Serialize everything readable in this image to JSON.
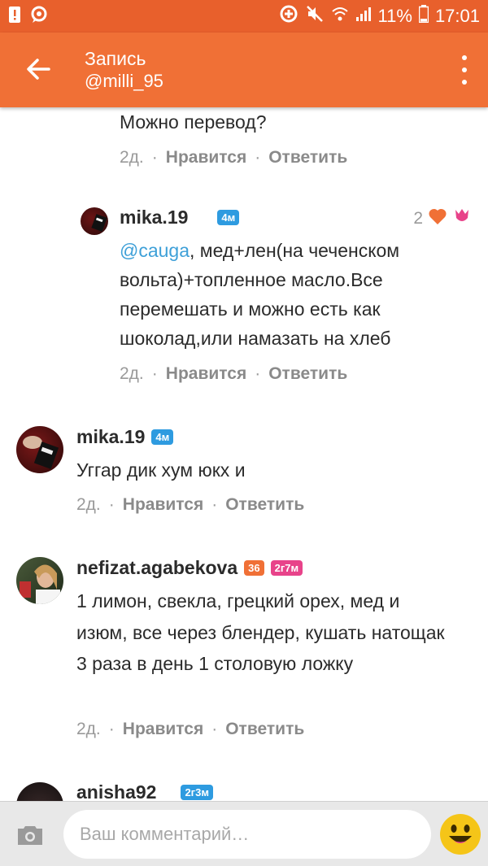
{
  "status": {
    "battery_pct": "11%",
    "time": "17:01"
  },
  "header": {
    "title": "Запись",
    "subtitle": "@milli_95"
  },
  "meta": {
    "like": "Нравится",
    "reply": "Ответить",
    "dot": "·"
  },
  "comments": [
    {
      "text": "Можно перевод?",
      "age": "2д."
    },
    {
      "user": "mika.19",
      "badge": "4м",
      "likes": "2",
      "mention": "@cauga",
      "text": ", мед+лен(на чеченском вольта)+топленное масло.Все перемешать и можно есть как шоколад,или намазать на хлеб",
      "age": "2д."
    },
    {
      "user": "mika.19",
      "badge": "4м",
      "text": "Уггар дик хум юкх и",
      "age": "2д."
    },
    {
      "user": "nefizat.agabekova",
      "badge1": "36",
      "badge2": "2г7м",
      "text": "1 лимон, свекла, грецкий орех, мед и изюм, все через блендер, кушать натощак 3 раза в день 1 столовую ложку",
      "age": "2д."
    },
    {
      "user": "anisha92",
      "badge": "2г3м"
    }
  ],
  "composer": {
    "placeholder": "Ваш комментарий…"
  },
  "colors": {
    "accent": "#f07036",
    "status_bar": "#e8602c",
    "link": "#3ea0d8",
    "badge_blue": "#2e9be0",
    "badge_pink": "#e8438a"
  }
}
